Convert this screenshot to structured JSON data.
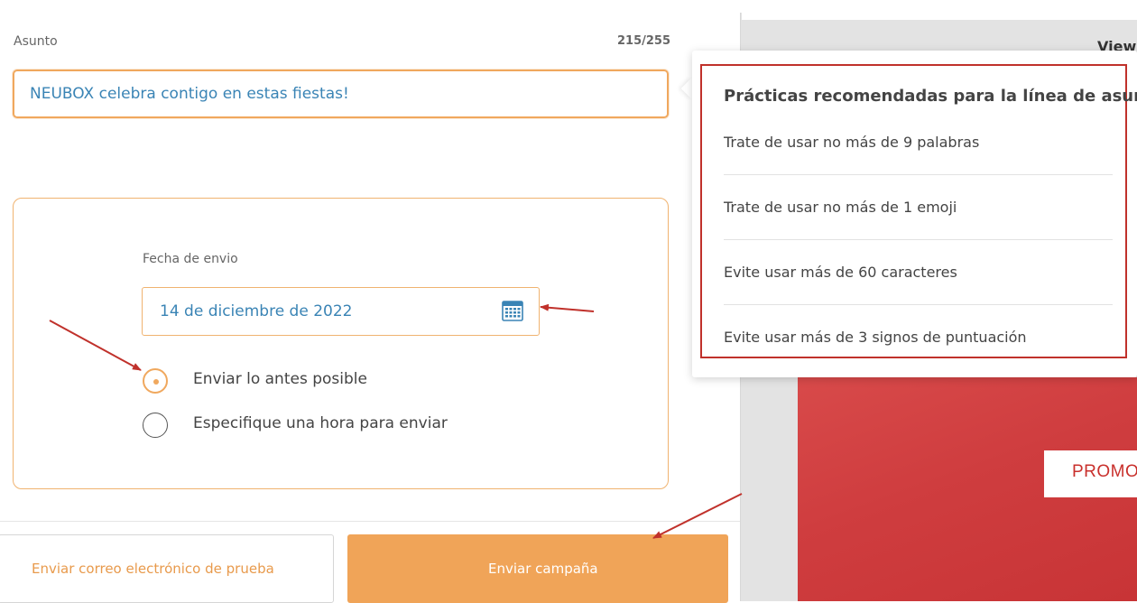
{
  "subject": {
    "label": "Asunto",
    "counter": "215/255",
    "value": "NEUBOX celebra contigo en estas fiestas!"
  },
  "schedule": {
    "date_label": "Fecha de envio",
    "date_value": "14 de diciembre de 2022",
    "options": [
      {
        "label": "Enviar lo antes posible",
        "selected": true
      },
      {
        "label": "Especifique una hora para enviar",
        "selected": false
      }
    ]
  },
  "footer": {
    "test_email_label": "Enviar correo electrónico de prueba",
    "send_campaign_label": "Enviar campaña"
  },
  "popover": {
    "title": "Prácticas recomendadas para la línea de asunto",
    "tips": [
      "Trate de usar no más de 9 palabras",
      "Trate de usar no más de 1 emoji",
      "Evite usar más de 60 caracteres",
      "Evite usar más de 3 signos de puntuación"
    ]
  },
  "preview": {
    "view_label": "View",
    "promo_text": "PROMOC"
  },
  "colors": {
    "accent": "#f0a458",
    "link_text": "#3a84b5",
    "annotation_red": "#c0312b",
    "promo_red": "#cf3d3f"
  }
}
